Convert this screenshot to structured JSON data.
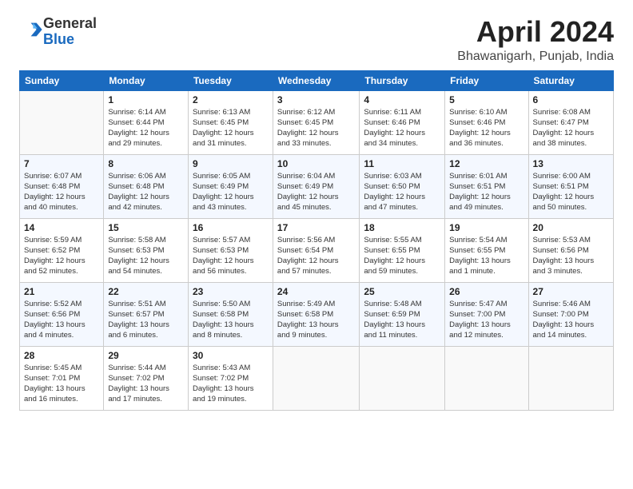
{
  "header": {
    "logo_general": "General",
    "logo_blue": "Blue",
    "month_title": "April 2024",
    "location": "Bhawanigarh, Punjab, India"
  },
  "weekdays": [
    "Sunday",
    "Monday",
    "Tuesday",
    "Wednesday",
    "Thursday",
    "Friday",
    "Saturday"
  ],
  "weeks": [
    [
      {
        "day": "",
        "info": ""
      },
      {
        "day": "1",
        "info": "Sunrise: 6:14 AM\nSunset: 6:44 PM\nDaylight: 12 hours\nand 29 minutes."
      },
      {
        "day": "2",
        "info": "Sunrise: 6:13 AM\nSunset: 6:45 PM\nDaylight: 12 hours\nand 31 minutes."
      },
      {
        "day": "3",
        "info": "Sunrise: 6:12 AM\nSunset: 6:45 PM\nDaylight: 12 hours\nand 33 minutes."
      },
      {
        "day": "4",
        "info": "Sunrise: 6:11 AM\nSunset: 6:46 PM\nDaylight: 12 hours\nand 34 minutes."
      },
      {
        "day": "5",
        "info": "Sunrise: 6:10 AM\nSunset: 6:46 PM\nDaylight: 12 hours\nand 36 minutes."
      },
      {
        "day": "6",
        "info": "Sunrise: 6:08 AM\nSunset: 6:47 PM\nDaylight: 12 hours\nand 38 minutes."
      }
    ],
    [
      {
        "day": "7",
        "info": "Sunrise: 6:07 AM\nSunset: 6:48 PM\nDaylight: 12 hours\nand 40 minutes."
      },
      {
        "day": "8",
        "info": "Sunrise: 6:06 AM\nSunset: 6:48 PM\nDaylight: 12 hours\nand 42 minutes."
      },
      {
        "day": "9",
        "info": "Sunrise: 6:05 AM\nSunset: 6:49 PM\nDaylight: 12 hours\nand 43 minutes."
      },
      {
        "day": "10",
        "info": "Sunrise: 6:04 AM\nSunset: 6:49 PM\nDaylight: 12 hours\nand 45 minutes."
      },
      {
        "day": "11",
        "info": "Sunrise: 6:03 AM\nSunset: 6:50 PM\nDaylight: 12 hours\nand 47 minutes."
      },
      {
        "day": "12",
        "info": "Sunrise: 6:01 AM\nSunset: 6:51 PM\nDaylight: 12 hours\nand 49 minutes."
      },
      {
        "day": "13",
        "info": "Sunrise: 6:00 AM\nSunset: 6:51 PM\nDaylight: 12 hours\nand 50 minutes."
      }
    ],
    [
      {
        "day": "14",
        "info": "Sunrise: 5:59 AM\nSunset: 6:52 PM\nDaylight: 12 hours\nand 52 minutes."
      },
      {
        "day": "15",
        "info": "Sunrise: 5:58 AM\nSunset: 6:53 PM\nDaylight: 12 hours\nand 54 minutes."
      },
      {
        "day": "16",
        "info": "Sunrise: 5:57 AM\nSunset: 6:53 PM\nDaylight: 12 hours\nand 56 minutes."
      },
      {
        "day": "17",
        "info": "Sunrise: 5:56 AM\nSunset: 6:54 PM\nDaylight: 12 hours\nand 57 minutes."
      },
      {
        "day": "18",
        "info": "Sunrise: 5:55 AM\nSunset: 6:55 PM\nDaylight: 12 hours\nand 59 minutes."
      },
      {
        "day": "19",
        "info": "Sunrise: 5:54 AM\nSunset: 6:55 PM\nDaylight: 13 hours\nand 1 minute."
      },
      {
        "day": "20",
        "info": "Sunrise: 5:53 AM\nSunset: 6:56 PM\nDaylight: 13 hours\nand 3 minutes."
      }
    ],
    [
      {
        "day": "21",
        "info": "Sunrise: 5:52 AM\nSunset: 6:56 PM\nDaylight: 13 hours\nand 4 minutes."
      },
      {
        "day": "22",
        "info": "Sunrise: 5:51 AM\nSunset: 6:57 PM\nDaylight: 13 hours\nand 6 minutes."
      },
      {
        "day": "23",
        "info": "Sunrise: 5:50 AM\nSunset: 6:58 PM\nDaylight: 13 hours\nand 8 minutes."
      },
      {
        "day": "24",
        "info": "Sunrise: 5:49 AM\nSunset: 6:58 PM\nDaylight: 13 hours\nand 9 minutes."
      },
      {
        "day": "25",
        "info": "Sunrise: 5:48 AM\nSunset: 6:59 PM\nDaylight: 13 hours\nand 11 minutes."
      },
      {
        "day": "26",
        "info": "Sunrise: 5:47 AM\nSunset: 7:00 PM\nDaylight: 13 hours\nand 12 minutes."
      },
      {
        "day": "27",
        "info": "Sunrise: 5:46 AM\nSunset: 7:00 PM\nDaylight: 13 hours\nand 14 minutes."
      }
    ],
    [
      {
        "day": "28",
        "info": "Sunrise: 5:45 AM\nSunset: 7:01 PM\nDaylight: 13 hours\nand 16 minutes."
      },
      {
        "day": "29",
        "info": "Sunrise: 5:44 AM\nSunset: 7:02 PM\nDaylight: 13 hours\nand 17 minutes."
      },
      {
        "day": "30",
        "info": "Sunrise: 5:43 AM\nSunset: 7:02 PM\nDaylight: 13 hours\nand 19 minutes."
      },
      {
        "day": "",
        "info": ""
      },
      {
        "day": "",
        "info": ""
      },
      {
        "day": "",
        "info": ""
      },
      {
        "day": "",
        "info": ""
      }
    ]
  ]
}
